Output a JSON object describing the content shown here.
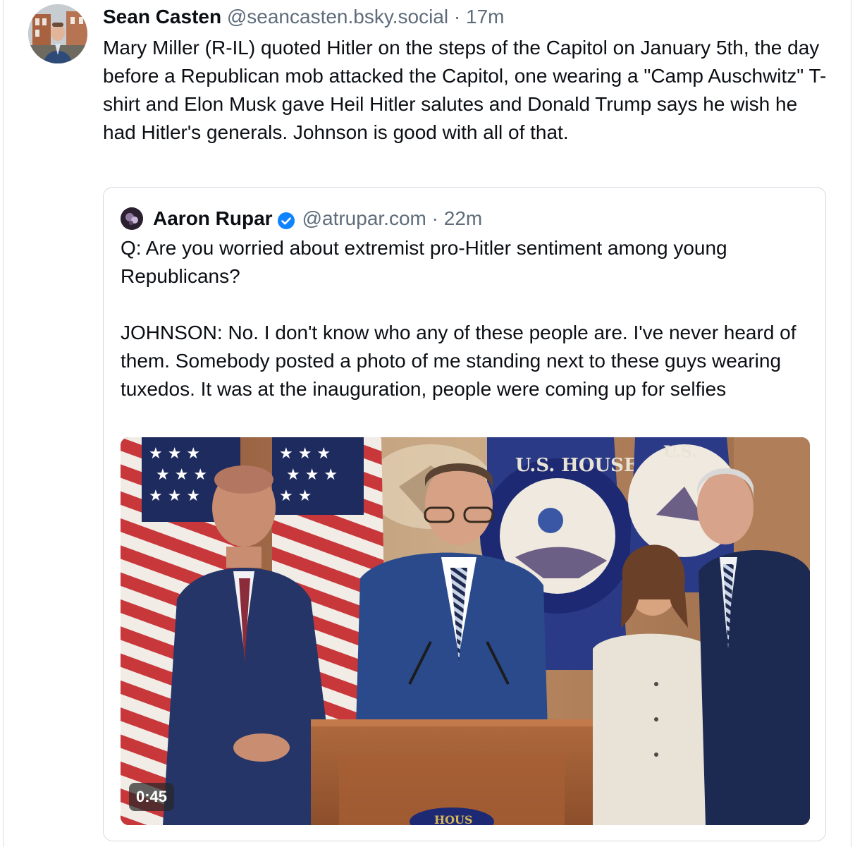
{
  "post": {
    "author": {
      "name": "Sean Casten",
      "handle": "@seancasten.bsky.social",
      "time": "17m",
      "separator": "·"
    },
    "text": "Mary Miller (R-IL) quoted Hitler on the steps of the Capitol on January 5th, the day before a Republican mob attacked the Capitol, one wearing a \"Camp Auschwitz\" T-shirt and Elon Musk gave Heil Hitler salutes and Donald Trump says he wish he had Hitler's generals.  Johnson is good with all of that."
  },
  "quote": {
    "author": {
      "name": "Aaron Rupar",
      "handle": "@atrupar.com",
      "time": "22m",
      "separator": "·",
      "verified_icon": "verified-badge-icon"
    },
    "paragraph_1": "Q: Are you worried about extremist pro-Hitler sentiment among young Republicans?",
    "paragraph_2": "JOHNSON: No. I don't know who any of these people are. I've never heard of them. Somebody posted a photo of me standing next to these guys wearing tuxedos. It was at the inauguration, people were coming up for selfies",
    "video": {
      "duration": "0:45",
      "seal_text_1": "U.S. HOUSE OF",
      "seal_text_2": "U.S.",
      "podium_text": "HOUS"
    }
  },
  "colors": {
    "text": "#0b0f14",
    "muted": "#5e6c7b",
    "border": "#d4d9df",
    "verified": "#1083fe"
  }
}
